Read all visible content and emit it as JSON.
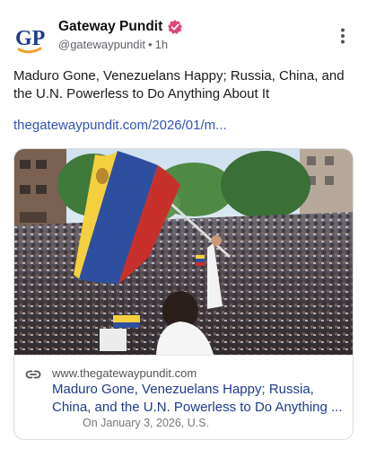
{
  "account": {
    "logo_text": "GP",
    "name": "Gateway Pundit",
    "handle": "@gatewaypundit",
    "separator": "•",
    "time": "1h"
  },
  "post": {
    "text": "Maduro Gone, Venezuelans Happy; Russia, China, and the U.N. Powerless to Do Anything About It",
    "link": "thegatewaypundit.com/2026/01/m..."
  },
  "card": {
    "domain": "www.thegatewaypundit.com",
    "title": "Maduro Gone, Venezuelans Happy; Russia, China, and the U.N. Powerless to Do Anything ...",
    "date": "On January 3, 2026, U.S."
  },
  "icons": {
    "verified": "verified-badge-icon",
    "more": "more-vertical-icon",
    "link": "link-icon"
  },
  "colors": {
    "brand_blue": "#1f3b8a",
    "link_blue": "#2f55b4",
    "verified_pink": "#e0457b",
    "logo_orange": "#f0a12a"
  }
}
